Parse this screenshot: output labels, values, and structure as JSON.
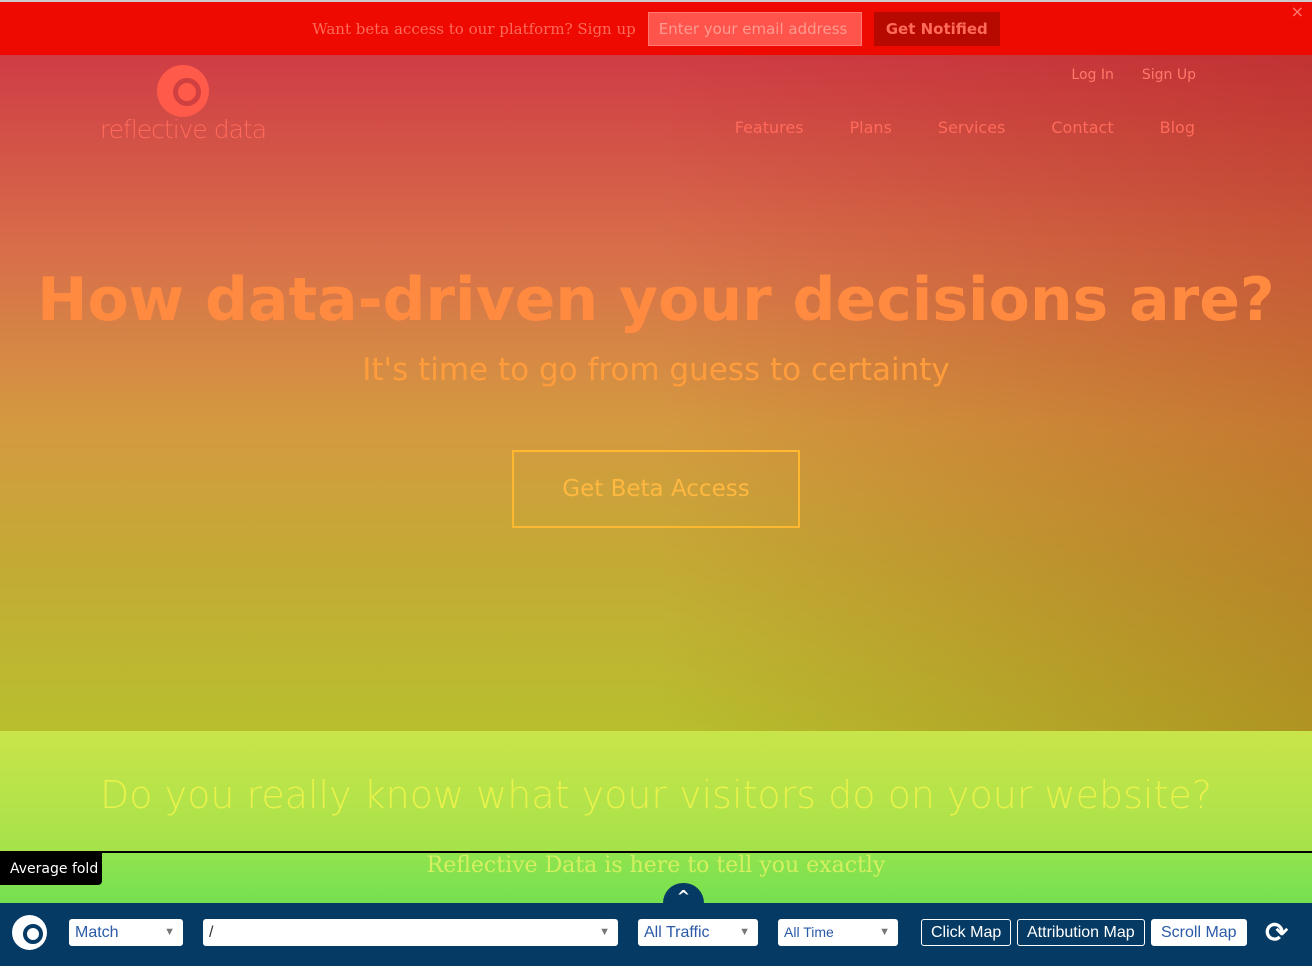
{
  "beta_bar": {
    "text": "Want beta access to our platform? Sign up",
    "email_placeholder": "Enter your email address",
    "button": "Get Notified",
    "close": "×"
  },
  "logo": {
    "text": "reflective data"
  },
  "top_links": [
    "Log In",
    "Sign Up"
  ],
  "nav": [
    "Features",
    "Plans",
    "Services",
    "Contact",
    "Blog"
  ],
  "hero": {
    "title": "How data-driven your decisions are?",
    "subtitle": "It's time to go from guess to certainty",
    "cta": "Get Beta Access"
  },
  "section": {
    "heading": "Do you really know what your visitors do on your website?",
    "subheading": "Reflective Data is here to tell you exactly"
  },
  "overlay": {
    "fold_label": "Average fold",
    "up_icon": "chevron-up-icon"
  },
  "toolbar": {
    "match": "Match",
    "path": "/",
    "traffic": "All Traffic",
    "time": "All Time",
    "buttons": [
      "Click Map",
      "Attribution Map",
      "Scroll Map"
    ],
    "active": "Scroll Map",
    "refresh_icon": "refresh-icon"
  },
  "colors": {
    "toolbar": "#053a64",
    "beta_bar": "#ee0a00"
  }
}
